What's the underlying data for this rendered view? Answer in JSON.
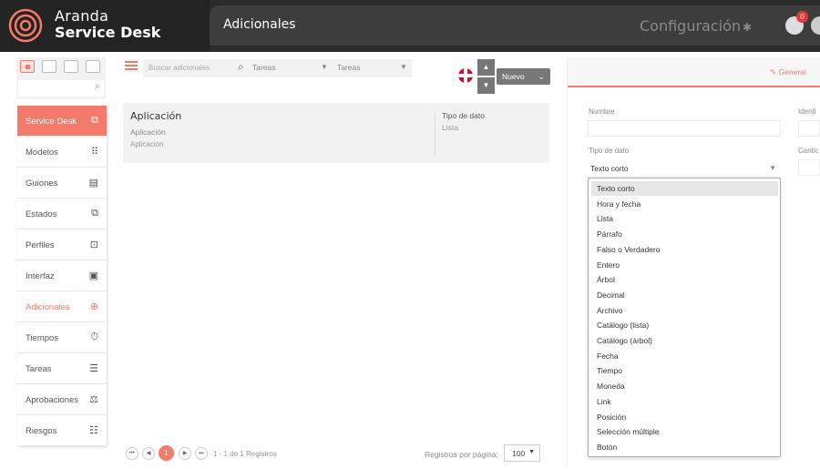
{
  "app": {
    "brand_line1": "Aranda",
    "brand_line2": "Service Desk",
    "page_title": "Adicionales",
    "config_label": "Configuración",
    "notification_count": "0"
  },
  "sidebar": {
    "items": [
      {
        "label": "Service Desk",
        "icon": "copy-icon",
        "glyph": "⧉",
        "state": "active"
      },
      {
        "label": "Modelos",
        "icon": "grid-icon",
        "glyph": "⠿",
        "state": ""
      },
      {
        "label": "Guiones",
        "icon": "script-icon",
        "glyph": "▤",
        "state": ""
      },
      {
        "label": "Estados",
        "icon": "states-icon",
        "glyph": "⧉",
        "state": ""
      },
      {
        "label": "Perfiles",
        "icon": "profile-icon",
        "glyph": "⊡",
        "state": ""
      },
      {
        "label": "Interfaz",
        "icon": "monitor-icon",
        "glyph": "▣",
        "state": ""
      },
      {
        "label": "Adicionales",
        "icon": "plus-circle-icon",
        "glyph": "⊕",
        "state": "selected"
      },
      {
        "label": "Tiempos",
        "icon": "stopwatch-icon",
        "glyph": "⏱",
        "state": ""
      },
      {
        "label": "Tareas",
        "icon": "tasks-icon",
        "glyph": "☰",
        "state": ""
      },
      {
        "label": "Aprobaciones",
        "icon": "approval-icon",
        "glyph": "⚖",
        "state": ""
      },
      {
        "label": "Riesgos",
        "icon": "risk-icon",
        "glyph": "☷",
        "state": ""
      }
    ]
  },
  "filters": {
    "search_placeholder": "Buscar adicionales",
    "select1": "Tareas",
    "select2": "Tareas",
    "new_button": "Nuevo"
  },
  "card": {
    "title": "Aplicación",
    "subtitle": "Aplicación",
    "subtitle2": "Aplicación",
    "type_header": "Tipo de dato",
    "type_value": "Lista"
  },
  "pager": {
    "current_page": "1",
    "info": "1 - 1 de 1 Registros",
    "rows_label": "Registros por página:",
    "rows_value": "100"
  },
  "panel": {
    "tab_general": "General",
    "name_label": "Nombre",
    "id_label": "Identi",
    "type_label": "Tipo de dato",
    "qty_label": "Cantic",
    "type_value": "Texto corto",
    "options": [
      "Texto corto",
      "Hora y fecha",
      "Lista",
      "Párrafo",
      "Falso o Verdadero",
      "Entero",
      "Árbol",
      "Decimal",
      "Archivo",
      "Catálogo (lista)",
      "Catálogo (árbol)",
      "Fecha",
      "Tiempo",
      "Moneda",
      "Link",
      "Posición",
      "Selección múltiple",
      "Botón"
    ]
  },
  "colors": {
    "accent": "#f47b6b",
    "topbar": "#2b2b2b"
  }
}
